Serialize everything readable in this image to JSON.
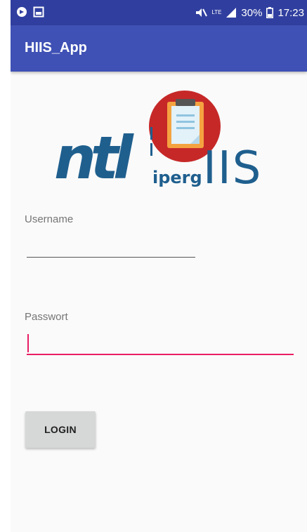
{
  "status_bar": {
    "battery": "30%",
    "time": "17:23",
    "network": "LTE",
    "icons": [
      "vpn-key-icon",
      "image-icon",
      "mute-icon",
      "signal-icon",
      "battery-icon"
    ]
  },
  "app_bar": {
    "title": "HIIS_App"
  },
  "logo": {
    "text_left": "ntl",
    "text_sub": "iperg",
    "text_right": "IIS",
    "colors": {
      "brand_blue": "#1f5f8e",
      "badge_red": "#c62828",
      "clipboard": "#f4a340"
    }
  },
  "form": {
    "username_label": "Username",
    "username_value": "",
    "password_label": "Passwort",
    "password_value": "",
    "login_label": "LOGIN"
  },
  "colors": {
    "primary": "#3f51b5",
    "primary_dark": "#303f9f",
    "accent": "#e91e63"
  }
}
